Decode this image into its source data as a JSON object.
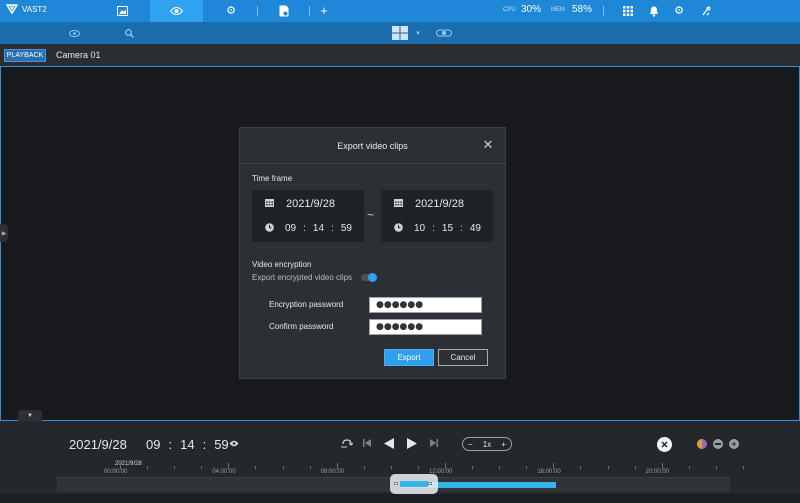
{
  "app": {
    "title": "VAST2"
  },
  "system": {
    "cpu_label": "CPU",
    "cpu_value": "30%",
    "mem_label": "MEM",
    "mem_value": "58%"
  },
  "view": {
    "mode_tab": "PLAYBACK",
    "camera_name": "Camera 01"
  },
  "dialog": {
    "title": "Export video clips",
    "time_frame_label": "Time frame",
    "start": {
      "date": "2021/9/28",
      "hh": "09",
      "mm": "14",
      "ss": "59"
    },
    "separator": "~",
    "end": {
      "date": "2021/9/28",
      "hh": "10",
      "mm": "15",
      "ss": "49"
    },
    "time_colon": ":",
    "encryption_section": "Video encryption",
    "encryption_toggle_label": "Export encrypted video clips",
    "encryption_enabled": true,
    "password_label": "Encryption password",
    "password_value": "●●●●●●",
    "confirm_label": "Confirm password",
    "confirm_value": "●●●●●●",
    "export_button": "Export",
    "cancel_button": "Cancel"
  },
  "playback": {
    "date": "2021/9/28",
    "hh": "09",
    "mm": "14",
    "ss": "59",
    "colon": ":",
    "speed": "1x",
    "speed_minus": "−",
    "speed_plus": "+"
  },
  "timeline": {
    "date_label": "2021/9/28",
    "ticks": [
      "00:00:00",
      "04:00:00",
      "08:00:00",
      "12:00:00",
      "16:00:00",
      "20:00:00"
    ]
  },
  "colors": {
    "accent": "#1f87d8",
    "active_tab": "#2fa3f0",
    "primary_button": "#2f9ff0",
    "timeline_fill": "#35b5ea"
  }
}
